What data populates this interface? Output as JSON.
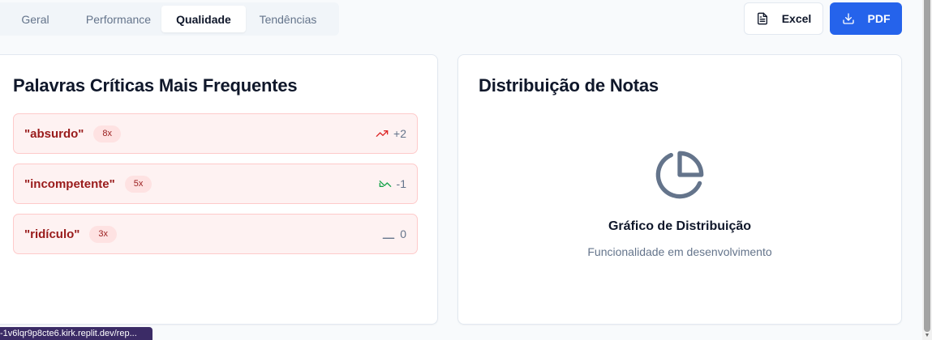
{
  "tabs": [
    {
      "label": "Geral",
      "active": false
    },
    {
      "label": "Performance",
      "active": false
    },
    {
      "label": "Qualidade",
      "active": true
    },
    {
      "label": "Tendências",
      "active": false
    }
  ],
  "export": {
    "excel_label": "Excel",
    "pdf_label": "PDF"
  },
  "critical_words": {
    "title": "Palavras Críticas Mais Frequentes",
    "items": [
      {
        "word": "\"absurdo\"",
        "count": "8x",
        "trend": "+2",
        "trend_direction": "up",
        "trend_color": "#dc2626"
      },
      {
        "word": "\"incompetente\"",
        "count": "5x",
        "trend": "-1",
        "trend_direction": "down",
        "trend_color": "#16a34a"
      },
      {
        "word": "\"ridículo\"",
        "count": "3x",
        "trend": "0",
        "trend_direction": "flat",
        "trend_color": "#64748b"
      }
    ]
  },
  "distribution": {
    "title": "Distribuição de Notas",
    "placeholder_icon": "pie-chart-icon",
    "placeholder_title": "Gráfico de Distribuição",
    "placeholder_subtitle": "Funcionalidade em desenvolvimento"
  },
  "status_bar": {
    "url": "-1v6lqr9p8cte6.kirk.replit.dev/rep..."
  },
  "colors": {
    "primary": "#2563eb",
    "critical_bg": "#fef2f2",
    "critical_border": "#fecaca",
    "critical_text": "#991b1b"
  }
}
